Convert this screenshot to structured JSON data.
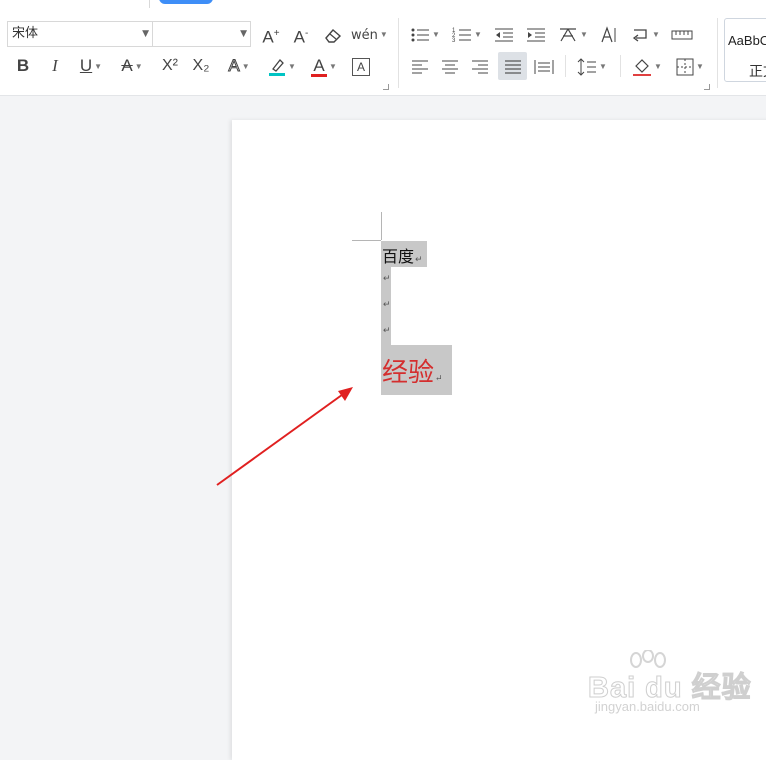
{
  "toolbar": {
    "font_name": "宋体",
    "font_size": "",
    "row1": {
      "grow_font_label": "A",
      "grow_font_mark": "+",
      "shrink_font_label": "A",
      "shrink_font_mark": "-",
      "pinyin_label": "wén"
    },
    "row2": {
      "bold_label": "B",
      "italic_label": "I",
      "underline_label": "U",
      "strike_label": "A",
      "superscript_label": "X²",
      "subscript_label": "X₂",
      "text_effect_label": "A",
      "font_color_label": "A",
      "char_border_label": "A"
    },
    "highlight_color": "#00c4c4",
    "font_color": "#e02020",
    "style_gallery": {
      "sample_text": "AaBbC",
      "style_name": "正文"
    }
  },
  "document": {
    "line1_text": "百度",
    "line2_text": "经验",
    "line2_color": "#d42e2e",
    "paragraph_mark": "↵",
    "selection_color": "#c8c8c8"
  },
  "annotation": {
    "arrow_color": "#e02020"
  },
  "watermark": {
    "logo_text": "Bai du 经验",
    "url": "jingyan.baidu.com"
  }
}
